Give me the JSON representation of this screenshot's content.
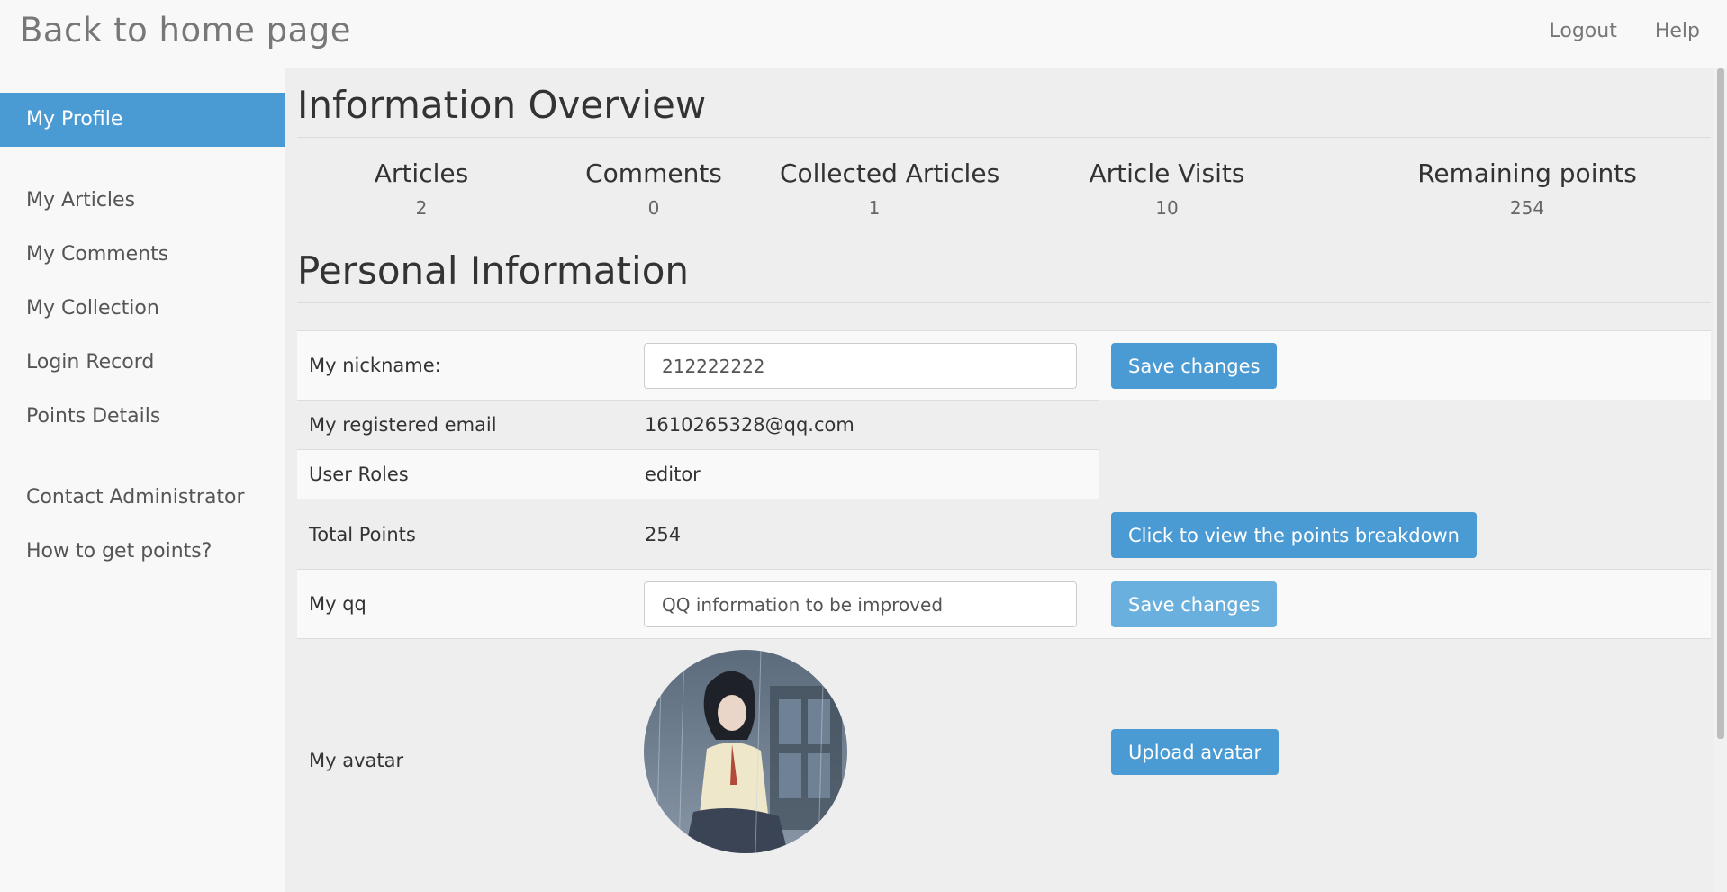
{
  "header": {
    "brand": "Back to home page",
    "nav": [
      "Logout",
      "Help"
    ]
  },
  "sidebar": {
    "active": "My Profile",
    "items": [
      "My Articles",
      "My Comments",
      "My Collection",
      "Login Record",
      "Points Details"
    ],
    "extra": [
      "Contact Administrator",
      "How to get points?"
    ]
  },
  "overview": {
    "title": "Information Overview",
    "stats": [
      {
        "label": "Articles",
        "value": "2"
      },
      {
        "label": "Comments",
        "value": "0"
      },
      {
        "label": "Collected Articles",
        "value": "1"
      },
      {
        "label": "Article Visits",
        "value": "10"
      },
      {
        "label": "Remaining points",
        "value": "254"
      }
    ]
  },
  "personal": {
    "title": "Personal Information",
    "nickname_label": "My nickname:",
    "nickname_value": "212222222",
    "save_label": "Save changes",
    "email_label": "My registered email",
    "email_value": "1610265328@qq.com",
    "roles_label": "User Roles",
    "roles_value": "editor",
    "points_label": "Total Points",
    "points_value": "254",
    "points_button": "Click to view the points breakdown",
    "qq_label": "My qq",
    "qq_value": "QQ information to be improved",
    "qq_save_label": "Save changes",
    "avatar_label": "My avatar",
    "upload_label": "Upload avatar"
  },
  "colors": {
    "accent": "#4a9ad4",
    "accent_light": "#6ab0de",
    "content_bg": "#eeeeee",
    "sidebar_bg": "#f8f8f8"
  }
}
